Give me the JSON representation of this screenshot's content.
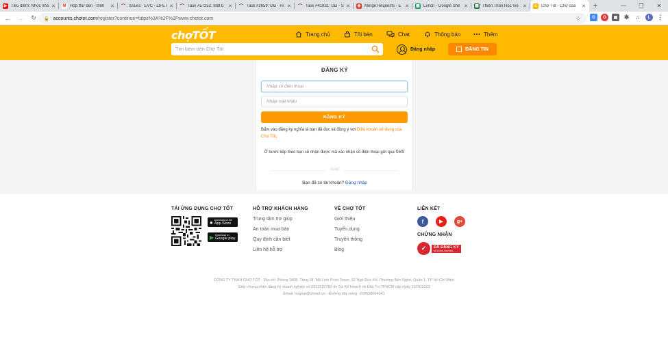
{
  "browser": {
    "tabs": [
      {
        "title": "Tiêu điểm: Nhọc nhằ",
        "icon": "youtube-icon",
        "color": "#ff0000"
      },
      {
        "title": "Hộp thư đến - trinh",
        "icon": "gmail-icon",
        "color": "#d93025"
      },
      {
        "title": "Issues · EVC - LIFET",
        "icon": "redmine-icon",
        "color": "#b22222"
      },
      {
        "title": "Task #57252: Mất b",
        "icon": "redmine-icon",
        "color": "#b22222"
      },
      {
        "title": "Task #2659: GĐ - Hi",
        "icon": "redmine-icon",
        "color": "#b22222"
      },
      {
        "title": "Task #41831: GĐ - S",
        "icon": "redmine-icon",
        "color": "#b22222"
      },
      {
        "title": "Merge Requests · E",
        "icon": "gitlab-icon",
        "color": "#e24329"
      },
      {
        "title": "Lunch - Google She",
        "icon": "sheets-icon",
        "color": "#0f9d58"
      },
      {
        "title": "Thiên Thần Học Việ",
        "icon": "spreadsheet-icon",
        "color": "#217346"
      },
      {
        "title": "Chợ Tốt - Chợ của",
        "icon": "chotot-icon",
        "color": "#ffba00"
      }
    ],
    "new_tab_glyph": "+",
    "window_controls": [
      "—",
      "❐",
      "✕"
    ],
    "url_host": "accounts.chotot.com",
    "url_path": "/register?continue=https%3A%2F%2Fwww.chotot.com"
  },
  "header": {
    "logo": "chợTỐT",
    "nav": [
      {
        "label": "Trang chủ",
        "icon": "home-icon"
      },
      {
        "label": "Tôi bán",
        "icon": "bag-icon"
      },
      {
        "label": "Chat",
        "icon": "chat-icon"
      },
      {
        "label": "Thông báo",
        "icon": "bell-icon"
      },
      {
        "label": "Thêm",
        "icon": "more-icon"
      }
    ],
    "search_placeholder": "Tìm kiếm trên Chợ Tốt",
    "login_label": "Đăng nhập",
    "post_label": "ĐĂNG TIN"
  },
  "register": {
    "title": "ĐĂNG KÝ",
    "phone_placeholder": "Nhập số điện thoại",
    "password_placeholder": "Nhập mật khẩu",
    "submit_label": "ĐĂNG KÝ",
    "terms_prefix": "Bấm vào đăng ký nghĩa là bạn đã đọc và đồng ý với ",
    "terms_link": "Điều khoản sử dụng của Chợ Tốt",
    "terms_suffix": ".",
    "sms_note": "Ở bước tiếp theo bạn sẽ nhận được mã xác nhận số điện thoại gửi qua SMS",
    "or_text": "hoặc",
    "have_account": "Bạn đã có tài khoản?",
    "login_link": "Đăng nhập"
  },
  "footer": {
    "app_heading": "TẢI ỨNG DỤNG CHỢ TỐT",
    "appstore_small": "Download on the",
    "appstore_label": "App Store",
    "googleplay_small": "Download on",
    "googleplay_label": "Google play",
    "support_heading": "HỖ TRỢ KHÁCH HÀNG",
    "support_links": [
      "Trung tâm trợ giúp",
      "An toàn mua bán",
      "Quy định cần biết",
      "Liên hệ hỗ trợ"
    ],
    "about_heading": "VỀ CHỢ TỐT",
    "about_links": [
      "Giới thiệu",
      "Tuyển dụng",
      "Truyền thông",
      "Blog"
    ],
    "social_heading": "LIÊN KẾT",
    "cert_heading": "CHỨNG NHẬN",
    "cert_line1": "ĐÃ ĐĂNG KÝ",
    "cert_line2": "BỘ CÔNG THƯƠNG",
    "company_line1": "CÔNG TY TNHH CHỢ TỐT - Địa chỉ: Phòng 1808, Tầng 18, Mê Linh Point Tower, 02 Ngô Đức Kế, Phường Bến Nghé, Quận 1, TP Hồ Chí Minh",
    "company_line2": "Giấy chứng nhận đăng ký doanh nghiệp số 0312120782 do Sở Kế Hoạch và Đầu Tư TPHCM cấp ngày 11/01/2013",
    "company_line3": "Email: trogiup@chotot.vn - Đường dây nóng: (028)38664041"
  },
  "colors": {
    "brand_yellow": "#ffba00",
    "brand_orange": "#ff8800",
    "link_blue": "#1a58b8"
  }
}
